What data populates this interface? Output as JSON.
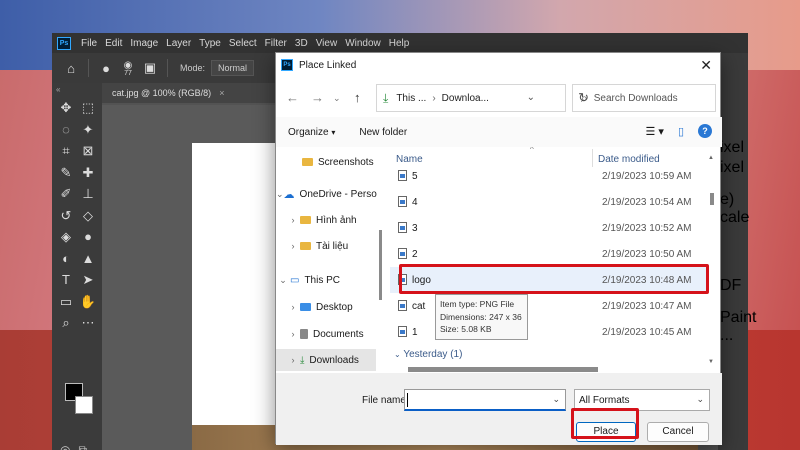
{
  "photoshop": {
    "menu": [
      "File",
      "Edit",
      "Image",
      "Layer",
      "Type",
      "Select",
      "Filter",
      "3D",
      "View",
      "Window",
      "Help"
    ],
    "logo": "Ps",
    "brush_size": "77",
    "mode_label": "Mode:",
    "mode_value": "Normal",
    "doc_tab": "cat.jpg @ 100% (RGB/8)",
    "panel_fragments": [
      "ixel",
      "ixel",
      "e)",
      "cale",
      "DF",
      "Paint ..."
    ]
  },
  "dialog": {
    "title": "Place Linked",
    "address": {
      "part1": "This ...",
      "part2": "Downloa..."
    },
    "search_placeholder": "Search Downloads",
    "organize": "Organize",
    "new_folder": "New folder",
    "help": "?",
    "nav_items": [
      {
        "label": "Screenshots",
        "type": "folder"
      },
      {
        "label": "OneDrive - Perso",
        "type": "cloud"
      },
      {
        "label": "Hình ảnh",
        "type": "folder"
      },
      {
        "label": "Tài liệu",
        "type": "folder"
      },
      {
        "label": "This PC",
        "type": "pc"
      },
      {
        "label": "Desktop",
        "type": "folder"
      },
      {
        "label": "Documents",
        "type": "folder"
      },
      {
        "label": "Downloads",
        "type": "download"
      }
    ],
    "columns": {
      "name": "Name",
      "date": "Date modified"
    },
    "files": [
      {
        "name": "5",
        "date": "2/19/2023 10:59 AM"
      },
      {
        "name": "4",
        "date": "2/19/2023 10:54 AM"
      },
      {
        "name": "3",
        "date": "2/19/2023 10:52 AM"
      },
      {
        "name": "2",
        "date": "2/19/2023 10:50 AM"
      },
      {
        "name": "logo",
        "date": "2/19/2023 10:48 AM"
      },
      {
        "name": "cat",
        "date": "2/19/2023 10:47 AM"
      },
      {
        "name": "1",
        "date": "2/19/2023 10:45 AM"
      }
    ],
    "group_yesterday": "Yesterday (1)",
    "tooltip": {
      "type": "Item type: PNG File",
      "dimensions": "Dimensions: 247 x 36",
      "size": "Size: 5.08 KB"
    },
    "file_name_label": "File name:",
    "file_name_value": "",
    "file_format": "All Formats",
    "place_button": "Place",
    "cancel_button": "Cancel"
  }
}
